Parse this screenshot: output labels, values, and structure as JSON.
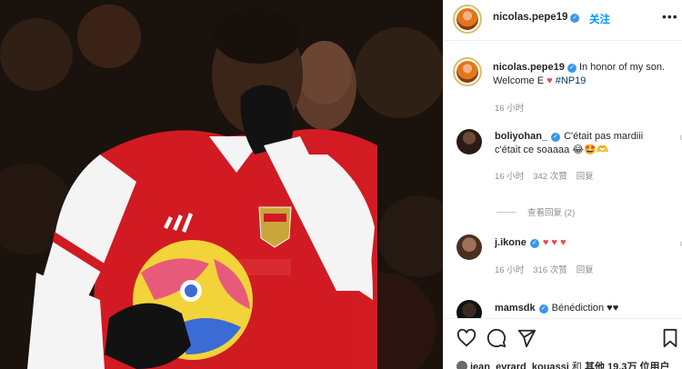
{
  "post": {
    "username": "nicolas.pepe19",
    "follow_label": "关注",
    "more_label": "•••",
    "caption_text": "In honor of my son. Welcome E",
    "caption_hashtag": "#NP19",
    "caption_time": "16 小时"
  },
  "comments": [
    {
      "username": "boliyohan_",
      "text": "C'était pas mardiii c'était ce soaaaa 😂🤩🫶",
      "time": "16 小时",
      "likes": "342 次赞",
      "reply": "回复",
      "verified": true
    },
    {
      "view_replies": "查看回复 (2)"
    },
    {
      "username": "j.ikone",
      "text": "",
      "time": "16 小时",
      "likes": "316 次赞",
      "reply": "回复",
      "verified": true
    },
    {
      "username": "mamsdk",
      "text": "Bénédiction ♥♥",
      "verified": true
    }
  ],
  "likes_summary": {
    "user": "jean_evrard_kouassi",
    "and_label": "和",
    "others": "其他 19.3万 位用户"
  },
  "colors": {
    "verified": "#3897f0",
    "follow": "#0095f6",
    "heart": "#ed4956",
    "muted_text": "#8e8e8e"
  },
  "icons": [
    "heart-icon",
    "comment-icon",
    "share-icon",
    "bookmark-icon",
    "more-icon",
    "verified-icon"
  ]
}
